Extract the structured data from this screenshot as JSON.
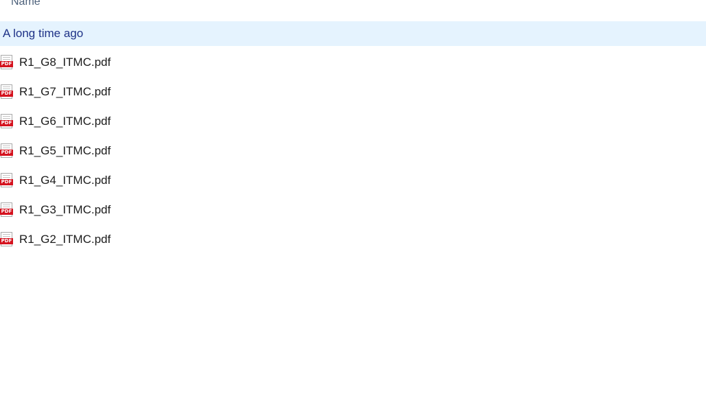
{
  "columns": {
    "name_label": "Name"
  },
  "group": {
    "label": "A long time ago"
  },
  "icons": {
    "file_icon": "pdf-icon",
    "badge_text": "PDF",
    "badge_color": "#d4121e"
  },
  "files": [
    {
      "name": "R1_G8_ITMC.pdf"
    },
    {
      "name": "R1_G7_ITMC.pdf"
    },
    {
      "name": "R1_G6_ITMC.pdf"
    },
    {
      "name": "R1_G5_ITMC.pdf"
    },
    {
      "name": "R1_G4_ITMC.pdf"
    },
    {
      "name": "R1_G3_ITMC.pdf"
    },
    {
      "name": "R1_G2_ITMC.pdf"
    }
  ]
}
